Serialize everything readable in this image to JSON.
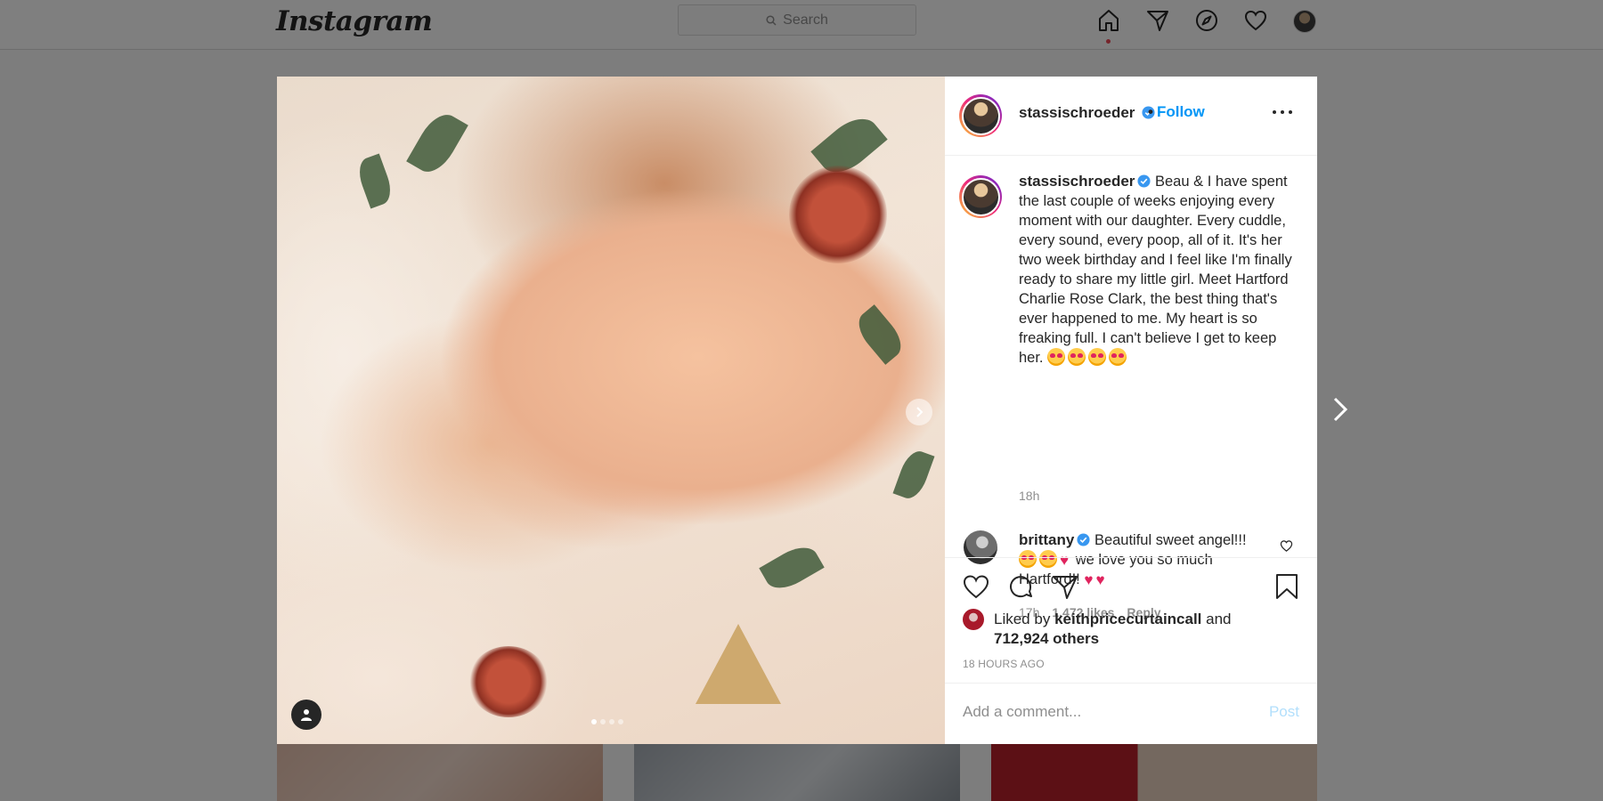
{
  "nav": {
    "logo": "Instagram",
    "search_placeholder": "Search",
    "icons": [
      "home-icon",
      "direct-icon",
      "explore-icon",
      "activity-heart-icon",
      "profile-avatar"
    ]
  },
  "post": {
    "author": "stassischroeder",
    "verified": true,
    "follow_label": "Follow",
    "follow_separator": "•",
    "caption": "Beau & I have spent the last couple of weeks enjoying every moment with our daughter. Every cuddle, every sound, every poop, all of it. It's her two week birthday and I feel like I'm finally ready to share my little girl. Meet Hartford Charlie Rose Clark, the best thing that's ever happened to me. My heart is so freaking full. I can't believe I get to keep her.",
    "caption_time": "18h",
    "carousel": {
      "count": 4,
      "active_index": 0
    }
  },
  "comments": [
    {
      "author": "brittany",
      "verified": true,
      "text_start": "Beautiful sweet angel!!!",
      "text_end": "we love you so much Hartford!!",
      "time": "17h",
      "likes": "1,472 likes",
      "reply_label": "Reply"
    }
  ],
  "engagement": {
    "liked_by_prefix": "Liked by",
    "liked_by_user": "keithpricecurtaincall",
    "liked_by_joiner": "and",
    "others": "712,924 others",
    "post_age": "18 HOURS AGO"
  },
  "comment_box": {
    "placeholder": "Add a comment...",
    "post_label": "Post"
  },
  "colors": {
    "accent": "#0095f6",
    "notification_dot": "#ed4956",
    "post_button_disabled": "#b2dffc"
  }
}
